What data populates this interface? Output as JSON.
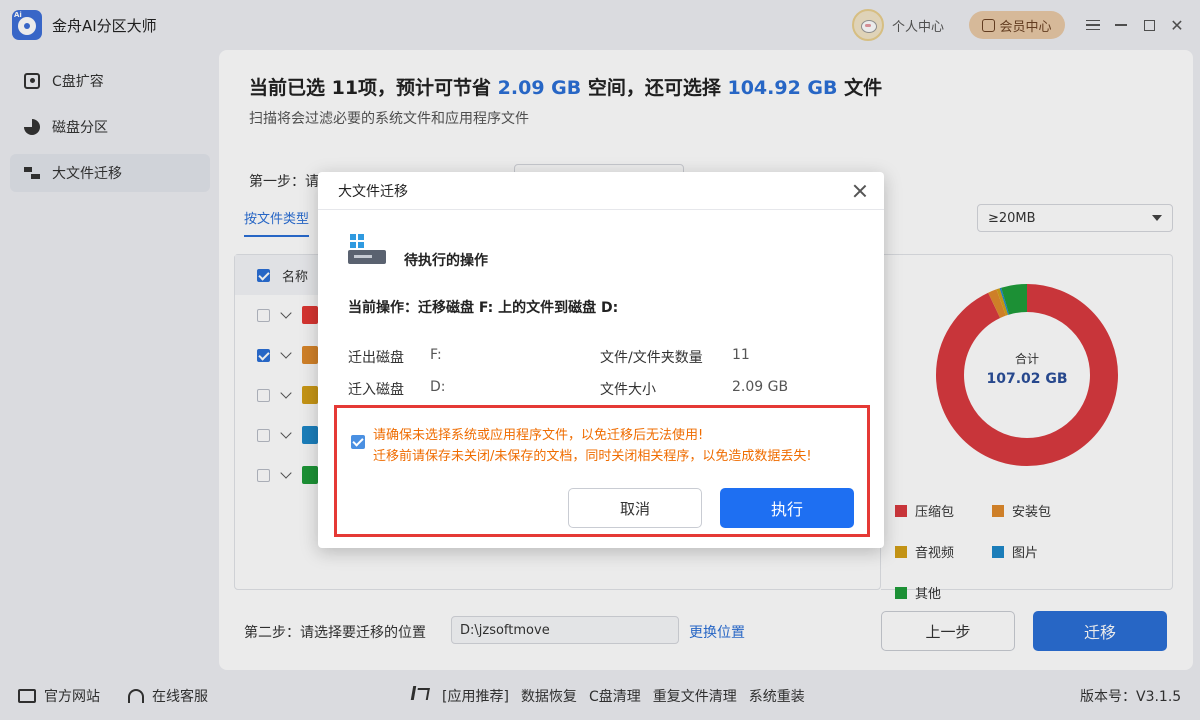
{
  "app": {
    "title": "金舟AI分区大师",
    "logo_text": "Ai"
  },
  "titlebar": {
    "user_center": "个人中心",
    "member_center": "会员中心"
  },
  "sidebar": {
    "items": [
      {
        "label": "C盘扩容",
        "icon": "c-drive-icon"
      },
      {
        "label": "磁盘分区",
        "icon": "pie-icon"
      },
      {
        "label": "大文件迁移",
        "icon": "file-move-icon",
        "active": true
      }
    ]
  },
  "main": {
    "headline": {
      "part1": "当前已选 11项，预计可节省 ",
      "size1": "2.09 GB",
      "part2": " 空间，还可选择 ",
      "size2": "104.92 GB",
      "part3": " 文件"
    },
    "subline": "扫描将会过滤必要的系统文件和应用程序文件",
    "step1_label": "第一步：请",
    "tab_by_type": "按文件类型",
    "size_filter": "≥20MB",
    "list": {
      "header_name": "名称",
      "rows": [
        {
          "checked": false,
          "color": "#e53935"
        },
        {
          "checked": true,
          "color": "#e08a2c"
        },
        {
          "checked": false,
          "color": "#d4a017"
        },
        {
          "checked": false,
          "color": "#1e88c9"
        },
        {
          "checked": false,
          "color": "#1f9d3a"
        }
      ]
    },
    "chart_data": {
      "type": "pie",
      "center_label": "合计",
      "center_value": "107.02 GB",
      "slices": [
        {
          "label": "压缩包",
          "value": 94.8,
          "color": "#d93a3f"
        },
        {
          "label": "安装包",
          "value": 1.6,
          "color": "#e08a2c"
        },
        {
          "label": "音视频",
          "value": 0.6,
          "color": "#d4a017"
        },
        {
          "label": "图片",
          "value": 0.3,
          "color": "#1e88c9"
        },
        {
          "label": "其他",
          "value": 4.7,
          "color": "#1f9d3a"
        }
      ]
    },
    "step2_label": "第二步：请选择要迁移的位置",
    "target_path": "D:\\jzsoftmove",
    "change_location": "更换位置",
    "prev_button": "上一步",
    "migrate_button": "迁移"
  },
  "footer": {
    "website": "官方网站",
    "support": "在线客服",
    "links": [
      "[应用推荐]",
      "数据恢复",
      "C盘清理",
      "重复文件清理",
      "系统重装"
    ],
    "version": "版本号：V3.1.5"
  },
  "dialog": {
    "title": "大文件迁移",
    "pending_title": "待执行的操作",
    "current_operation": "当前操作：迁移磁盘 F: 上的文件到磁盘 D:",
    "source_label": "迁出磁盘",
    "source_value": "F:",
    "target_label": "迁入磁盘",
    "target_value": "D:",
    "count_label": "文件/文件夹数量",
    "count_value": "11",
    "size_label": "文件大小",
    "size_value": "2.09 GB",
    "warning_line1": "请确保未选择系统或应用程序文件，以免迁移后无法使用!",
    "warning_line2": "迁移前请保存未关闭/未保存的文档，同时关闭相关程序，以免造成数据丢失!",
    "cancel_button": "取消",
    "execute_button": "执行"
  }
}
